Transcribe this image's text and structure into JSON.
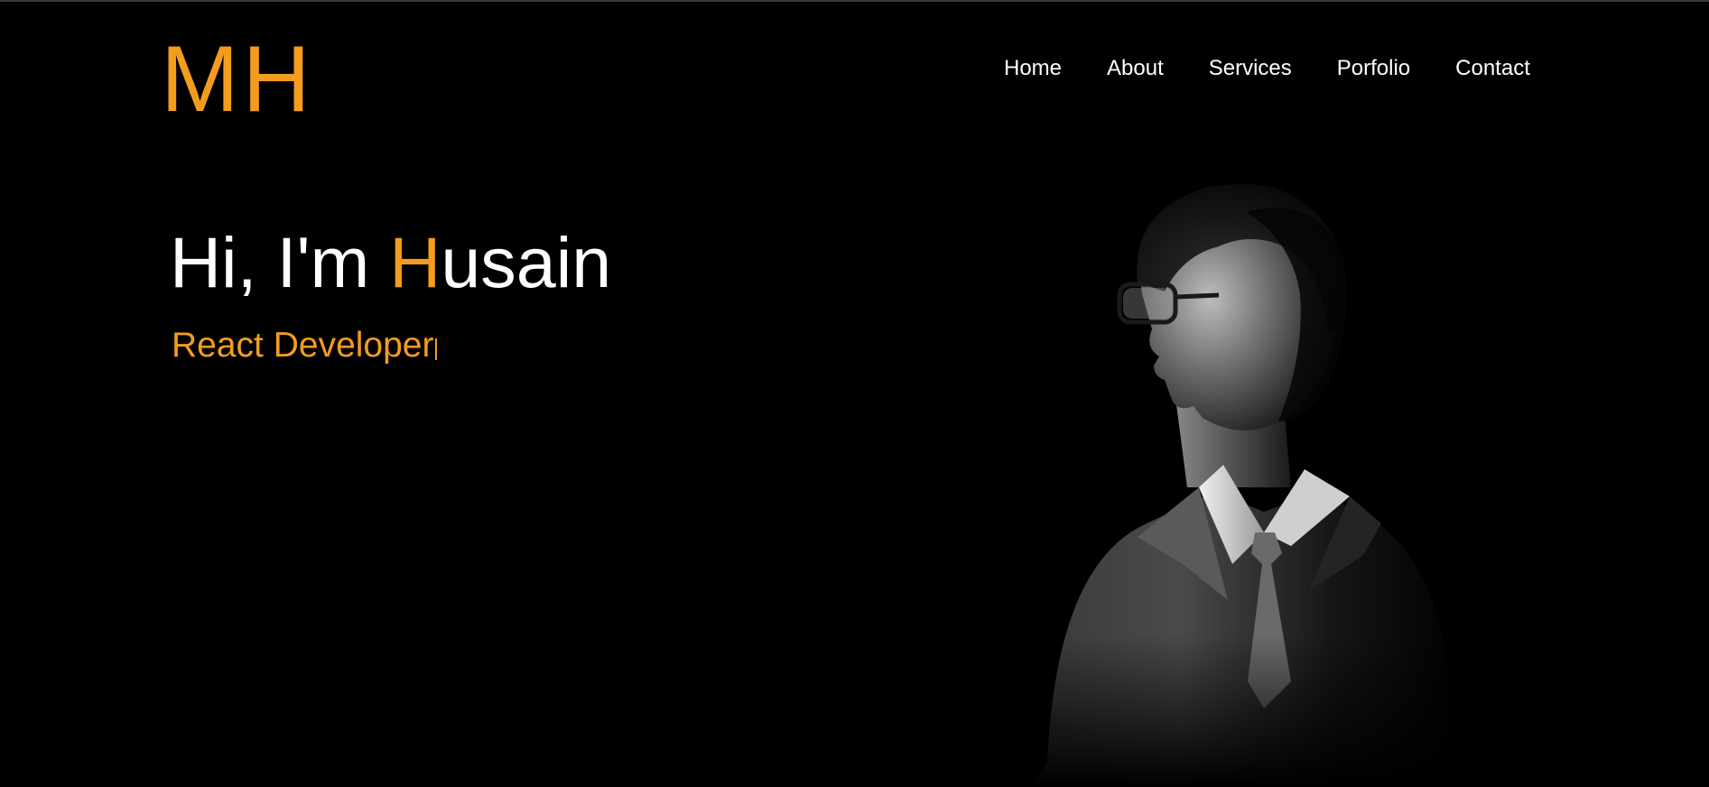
{
  "header": {
    "logo_text": "MH",
    "nav": [
      {
        "label": "Home"
      },
      {
        "label": "About"
      },
      {
        "label": "Services"
      },
      {
        "label": "Porfolio"
      },
      {
        "label": "Contact"
      }
    ]
  },
  "hero": {
    "greeting_prefix": "Hi, I'm ",
    "name_first_letter": "H",
    "name_rest": "usain",
    "role": "React Developer"
  },
  "colors": {
    "accent": "#f39c1e",
    "background": "#000000",
    "text": "#ffffff"
  },
  "icons": {
    "portrait": "portrait-photo-image"
  }
}
